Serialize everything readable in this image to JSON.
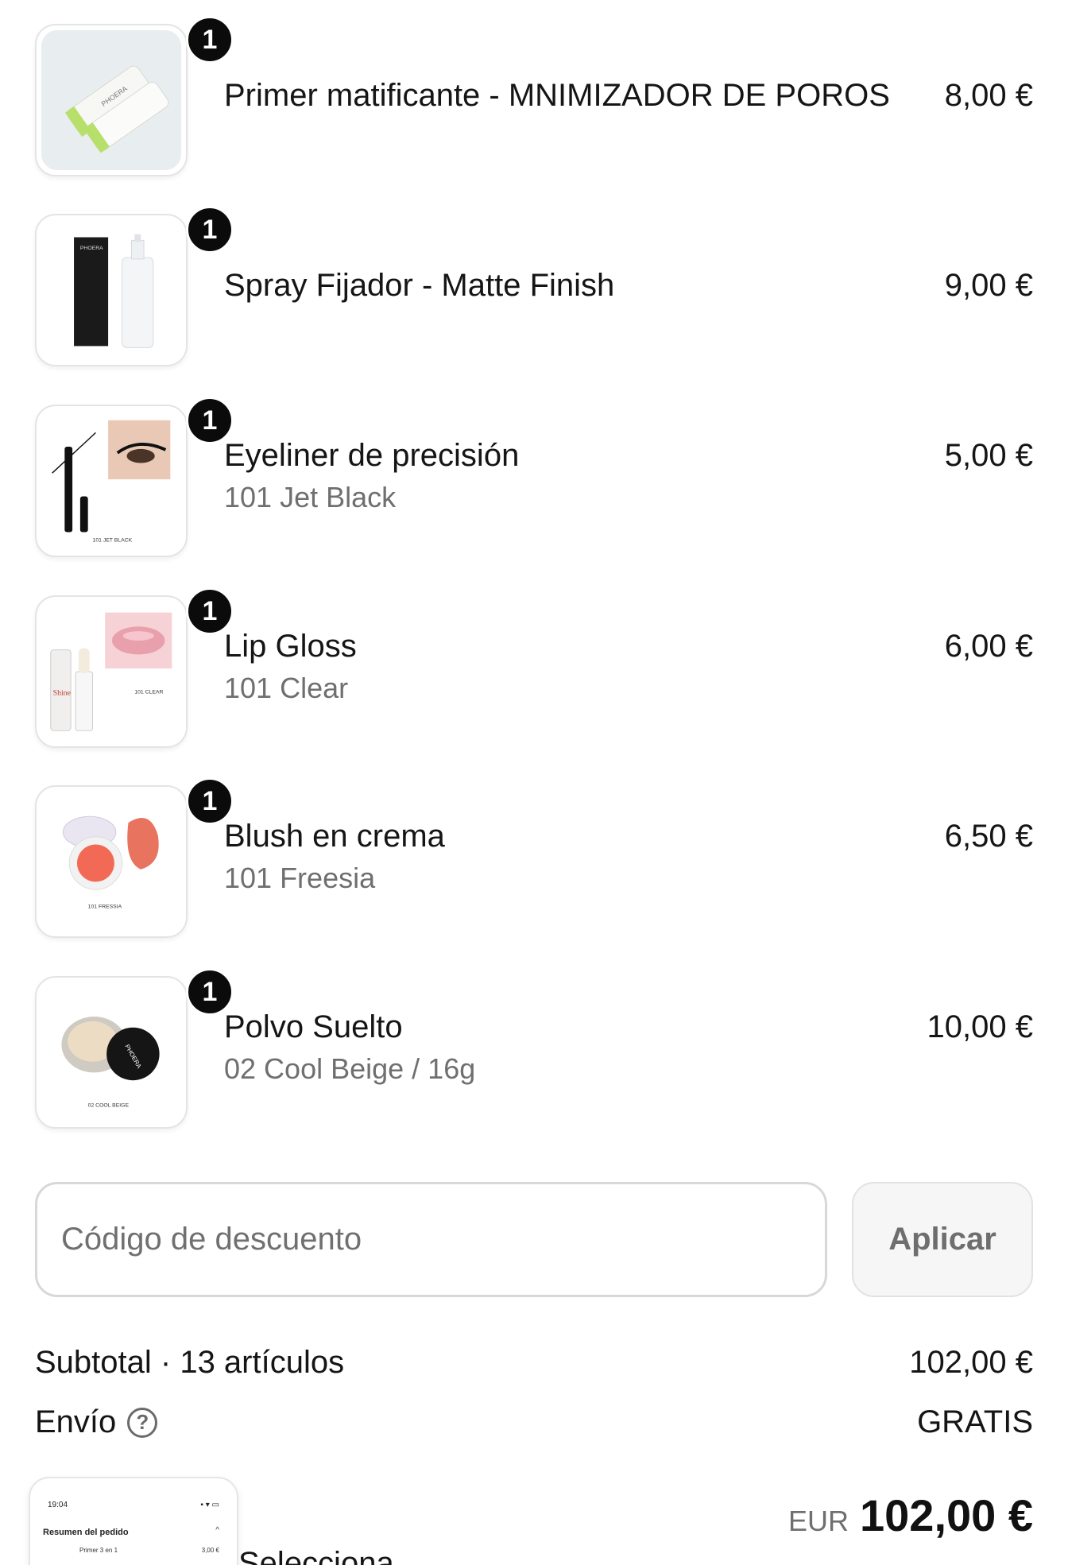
{
  "line_items": [
    {
      "qty": "1",
      "title": "Primer matificante - MNIMIZADOR DE POROS",
      "variant": "",
      "price": "8,00 €",
      "image": "primer-tubes"
    },
    {
      "qty": "1",
      "title": "Spray Fijador - Matte Finish",
      "variant": "",
      "price": "9,00 €",
      "image": "setting-spray"
    },
    {
      "qty": "1",
      "title": "Eyeliner de precisión",
      "variant": "101 Jet Black",
      "price": "5,00 €",
      "image": "eyeliner",
      "image_caption": "101 JET BLACK"
    },
    {
      "qty": "1",
      "title": "Lip Gloss",
      "variant": "101 Clear",
      "price": "6,00 €",
      "image": "lip-gloss",
      "image_caption": "101 CLEAR"
    },
    {
      "qty": "1",
      "title": "Blush en crema",
      "variant": "101 Freesia",
      "price": "6,50 €",
      "image": "cream-blush",
      "image_caption": "101 FRESSIA"
    },
    {
      "qty": "1",
      "title": "Polvo Suelto",
      "variant": "02 Cool Beige / 16g",
      "price": "10,00 €",
      "image": "loose-powder",
      "image_caption": "02 COOL BEIGE"
    }
  ],
  "discount": {
    "placeholder": "Código de descuento",
    "apply_label": "Aplicar"
  },
  "summary": {
    "subtotal_label": "Subtotal · 13 artículos",
    "subtotal_value": "102,00 €",
    "shipping_label": "Envío",
    "shipping_value": "GRATIS",
    "total_currency": "EUR",
    "total_value": "102,00 €"
  },
  "mini_screenshot": {
    "status_time": "19:04",
    "title": "Resumen del pedido",
    "item_text": "Primer 3 en 1",
    "item_price": "3,00 €"
  },
  "peek_text": "Selecciona ..."
}
